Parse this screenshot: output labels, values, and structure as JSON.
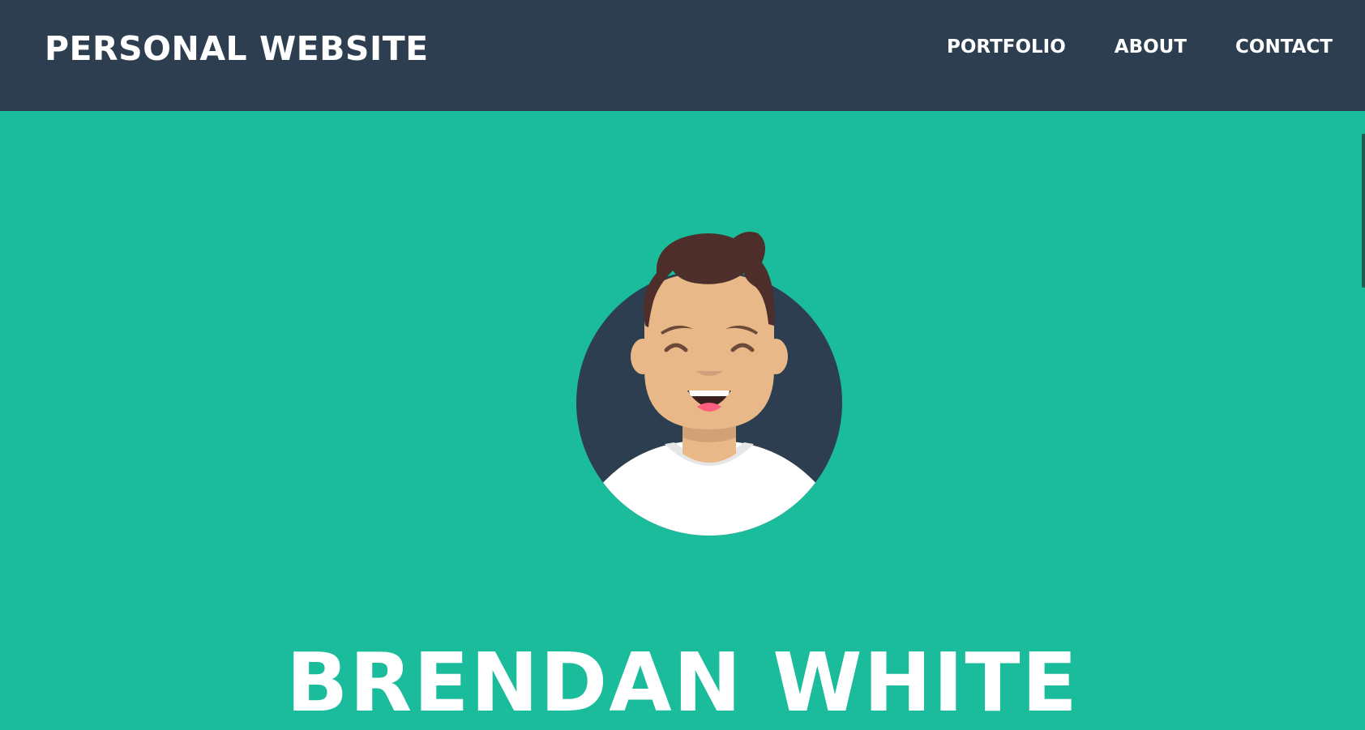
{
  "navbar": {
    "brand": "PERSONAL WEBSITE",
    "links": [
      {
        "label": "PORTFOLIO"
      },
      {
        "label": "ABOUT"
      },
      {
        "label": "CONTACT"
      }
    ]
  },
  "hero": {
    "name": "BRENDAN WHITE",
    "avatar_icon": "avatar-illustration"
  },
  "colors": {
    "navbar_bg": "#2c3e50",
    "hero_bg": "#1abc9c",
    "text": "#ffffff"
  }
}
